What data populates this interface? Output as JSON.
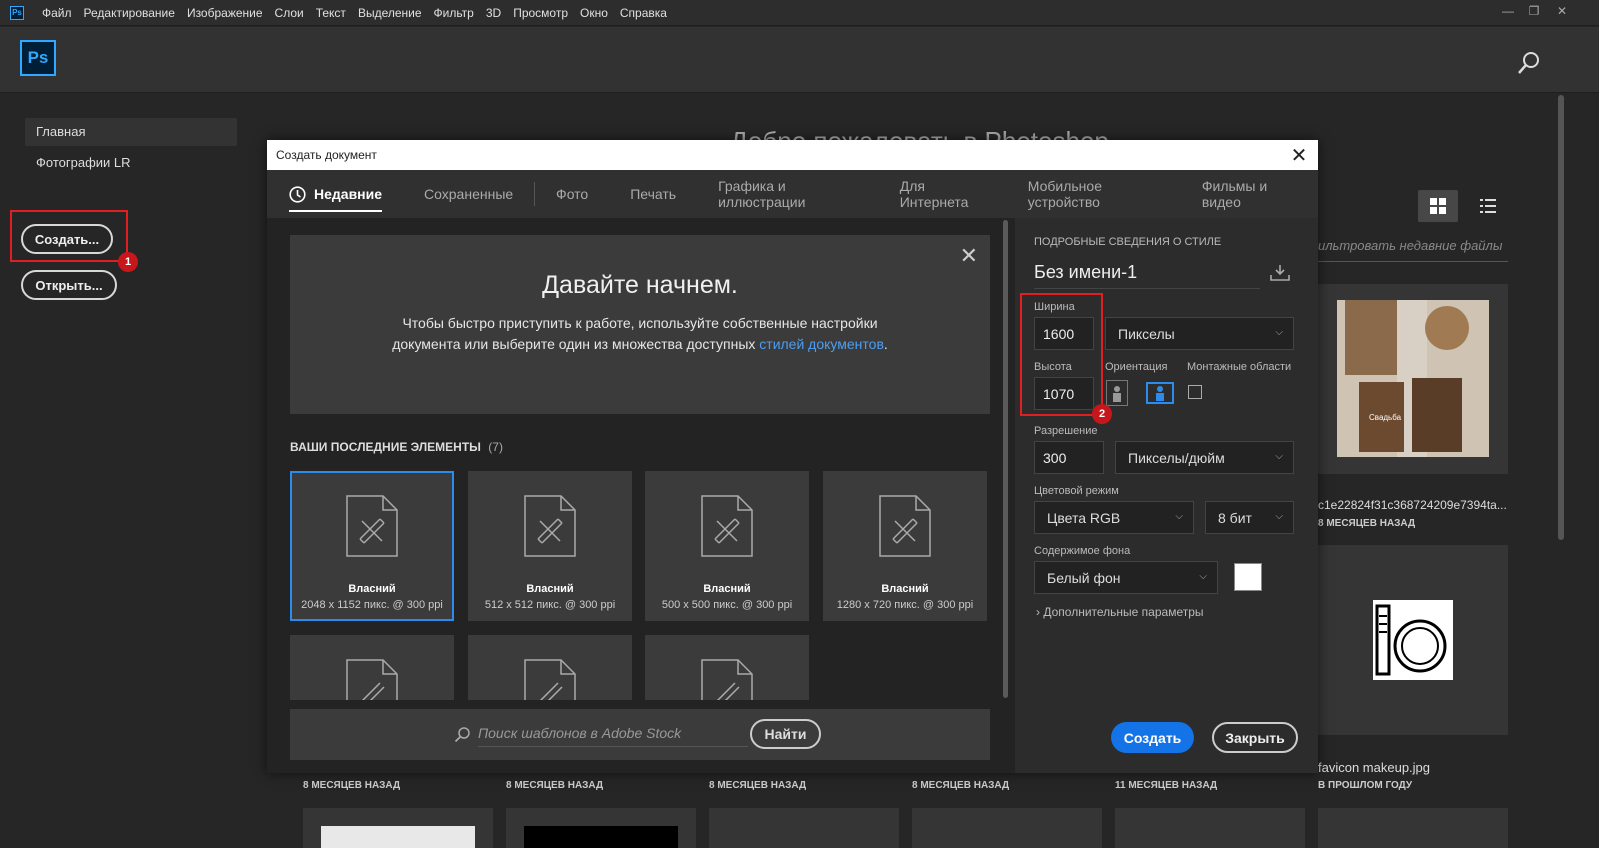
{
  "menubar": {
    "app_icon": "Ps",
    "items": [
      "Файл",
      "Редактирование",
      "Изображение",
      "Слои",
      "Текст",
      "Выделение",
      "Фильтр",
      "3D",
      "Просмотр",
      "Окно",
      "Справка"
    ],
    "window_controls": [
      "—",
      "❐",
      "✕"
    ]
  },
  "header": {
    "logo": "Ps"
  },
  "sidebar": {
    "items": [
      "Главная",
      "Фотографии LR"
    ],
    "create_label": "Создать...",
    "open_label": "Открыть..."
  },
  "badges": [
    "1",
    "2"
  ],
  "home": {
    "welcome": "Добро пожаловать в Photoshop",
    "filter_placeholder": "ильтровать недавние файлы",
    "file_names": [
      "c1e22824f31c368724209e7394ta...",
      "favicon makeup.jpg"
    ],
    "file_times": [
      "8 МЕСЯЦЕВ НАЗАД",
      "В ПРОШЛОМ ГОДУ"
    ],
    "bottom_times": [
      "8 МЕСЯЦЕВ НАЗАД",
      "8 МЕСЯЦЕВ НАЗАД",
      "8 МЕСЯЦЕВ НАЗАД",
      "8 МЕСЯЦЕВ НАЗАД",
      "11 МЕСЯЦЕВ НАЗАД"
    ]
  },
  "dialog": {
    "title": "Создать документ",
    "tabs": [
      "Недавние",
      "Сохраненные",
      "Фото",
      "Печать",
      "Графика и иллюстрации",
      "Для Интернета",
      "Мобильное устройство",
      "Фильмы и видео"
    ],
    "getstarted": {
      "title": "Давайте начнем.",
      "text": "Чтобы быстро приступить к работе, используйте собственные настройки документа или выберите один из множества доступных ",
      "link": "стилей документов",
      "end": "."
    },
    "recent_header": "ВАШИ ПОСЛЕДНИЕ ЭЛЕМЕНТЫ",
    "recent_count": "(7)",
    "presets": [
      {
        "name": "Власний",
        "dim": "2048 x 1152 пикс. @ 300 ppi"
      },
      {
        "name": "Власний",
        "dim": "512 x 512 пикс. @ 300 ppi"
      },
      {
        "name": "Власний",
        "dim": "500 x 500 пикс. @ 300 ppi"
      },
      {
        "name": "Власний",
        "dim": "1280 x 720 пикс. @ 300 ppi"
      }
    ],
    "stock_placeholder": "Поиск шаблонов в Adobe Stock",
    "find_label": "Найти",
    "panel": {
      "header": "ПОДРОБНЫЕ СВЕДЕНИЯ О СТИЛЕ",
      "doc_name": "Без имени-1",
      "width_label": "Ширина",
      "width": "1600",
      "units": "Пикселы",
      "height_label": "Высота",
      "height": "1070",
      "orientation_label": "Ориентация",
      "artboards_label": "Монтажные области",
      "resolution_label": "Разрешение",
      "resolution": "300",
      "resolution_units": "Пикселы/дюйм",
      "color_mode_label": "Цветовой режим",
      "color_mode": "Цвета RGB",
      "bit_depth": "8 бит",
      "bg_label": "Содержимое фона",
      "bg": "Белый фон",
      "advanced": "Дополнительные параметры",
      "create_label": "Создать",
      "close_label": "Закрыть"
    }
  }
}
